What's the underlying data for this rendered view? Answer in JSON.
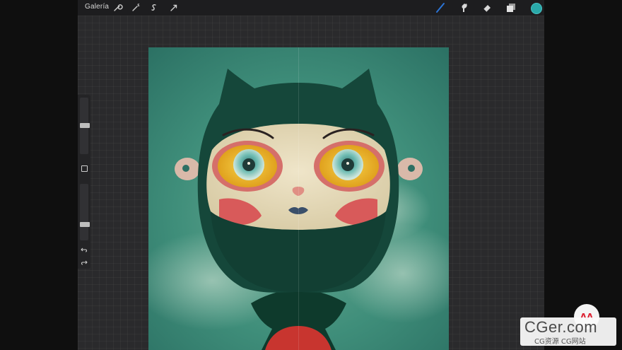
{
  "topbar": {
    "gallery_label": "Galería",
    "left_tools": [
      "wrench-icon",
      "magic-wand-icon",
      "selection-icon",
      "transform-arrow-icon"
    ],
    "right_tools": [
      "brush-icon",
      "smudge-icon",
      "eraser-icon",
      "layers-icon"
    ],
    "active_color": "#2aa9a9",
    "active_tool_color": "#2b74d6"
  },
  "sidebar": {
    "brush_size_level": 0.5,
    "opacity_level": 0.75,
    "icons": [
      "square-modify-icon",
      "undo-icon",
      "redo-icon"
    ]
  },
  "canvas": {
    "background_color": "#3f8e7a",
    "subject": "cat-masked-character-illustration"
  },
  "watermark": {
    "logo_text": "ΛΛ",
    "main_text": "CGer.com",
    "sub_text": "CG资源 CG网站"
  }
}
